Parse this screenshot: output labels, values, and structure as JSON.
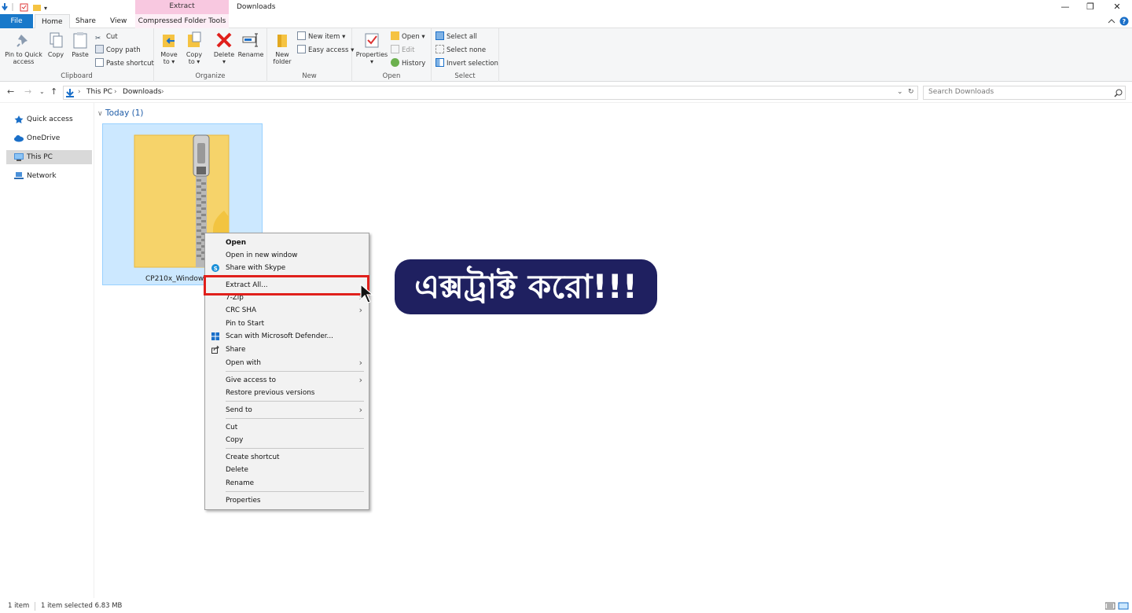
{
  "titlebar": {
    "context_tab_header": "Extract",
    "window_title": "Downloads",
    "minimize": "—",
    "restore": "❐",
    "close": "✕"
  },
  "tabs": {
    "file": "File",
    "home": "Home",
    "share": "Share",
    "view": "View",
    "compressed": "Compressed Folder Tools"
  },
  "ribbon": {
    "clipboard": {
      "label": "Clipboard",
      "pin": "Pin to Quick access",
      "copy": "Copy",
      "paste": "Paste",
      "cut": "Cut",
      "copy_path": "Copy path",
      "paste_shortcut": "Paste shortcut"
    },
    "organize": {
      "label": "Organize",
      "move_to": "Move to ▾",
      "copy_to": "Copy to ▾",
      "delete": "Delete ▾",
      "rename": "Rename"
    },
    "new": {
      "label": "New",
      "new_folder": "New folder",
      "new_item": "New item ▾",
      "easy_access": "Easy access ▾"
    },
    "open": {
      "label": "Open",
      "properties": "Properties ▾",
      "open": "Open ▾",
      "edit": "Edit",
      "history": "History"
    },
    "select": {
      "label": "Select",
      "select_all": "Select all",
      "select_none": "Select none",
      "invert": "Invert selection"
    }
  },
  "address": {
    "crumb1": "This PC",
    "crumb2": "Downloads",
    "search_placeholder": "Search Downloads"
  },
  "nav": {
    "quick_access": "Quick access",
    "onedrive": "OneDrive",
    "this_pc": "This PC",
    "network": "Network"
  },
  "content": {
    "group_header": "Today (1)",
    "file_name": "CP210x_Windows_Dr"
  },
  "context_menu": {
    "open": "Open",
    "open_new_window": "Open in new window",
    "share_skype": "Share with Skype",
    "extract_all": "Extract All...",
    "seven_zip": "7-Zip",
    "crc_sha": "CRC SHA",
    "pin_start": "Pin to Start",
    "scan_defender": "Scan with Microsoft Defender...",
    "share": "Share",
    "open_with": "Open with",
    "give_access": "Give access to",
    "restore_prev": "Restore previous versions",
    "send_to": "Send to",
    "cut": "Cut",
    "copy": "Copy",
    "create_shortcut": "Create shortcut",
    "delete": "Delete",
    "rename": "Rename",
    "properties": "Properties"
  },
  "banner": {
    "text": "এক্সট্রাক্ট করো!!!"
  },
  "status": {
    "items": "1 item",
    "selected": "1 item selected  6.83 MB"
  },
  "colors": {
    "accent": "#1979ca",
    "selection": "#cce8ff",
    "highlight": "#e0201c",
    "banner_bg": "#1f2060"
  }
}
